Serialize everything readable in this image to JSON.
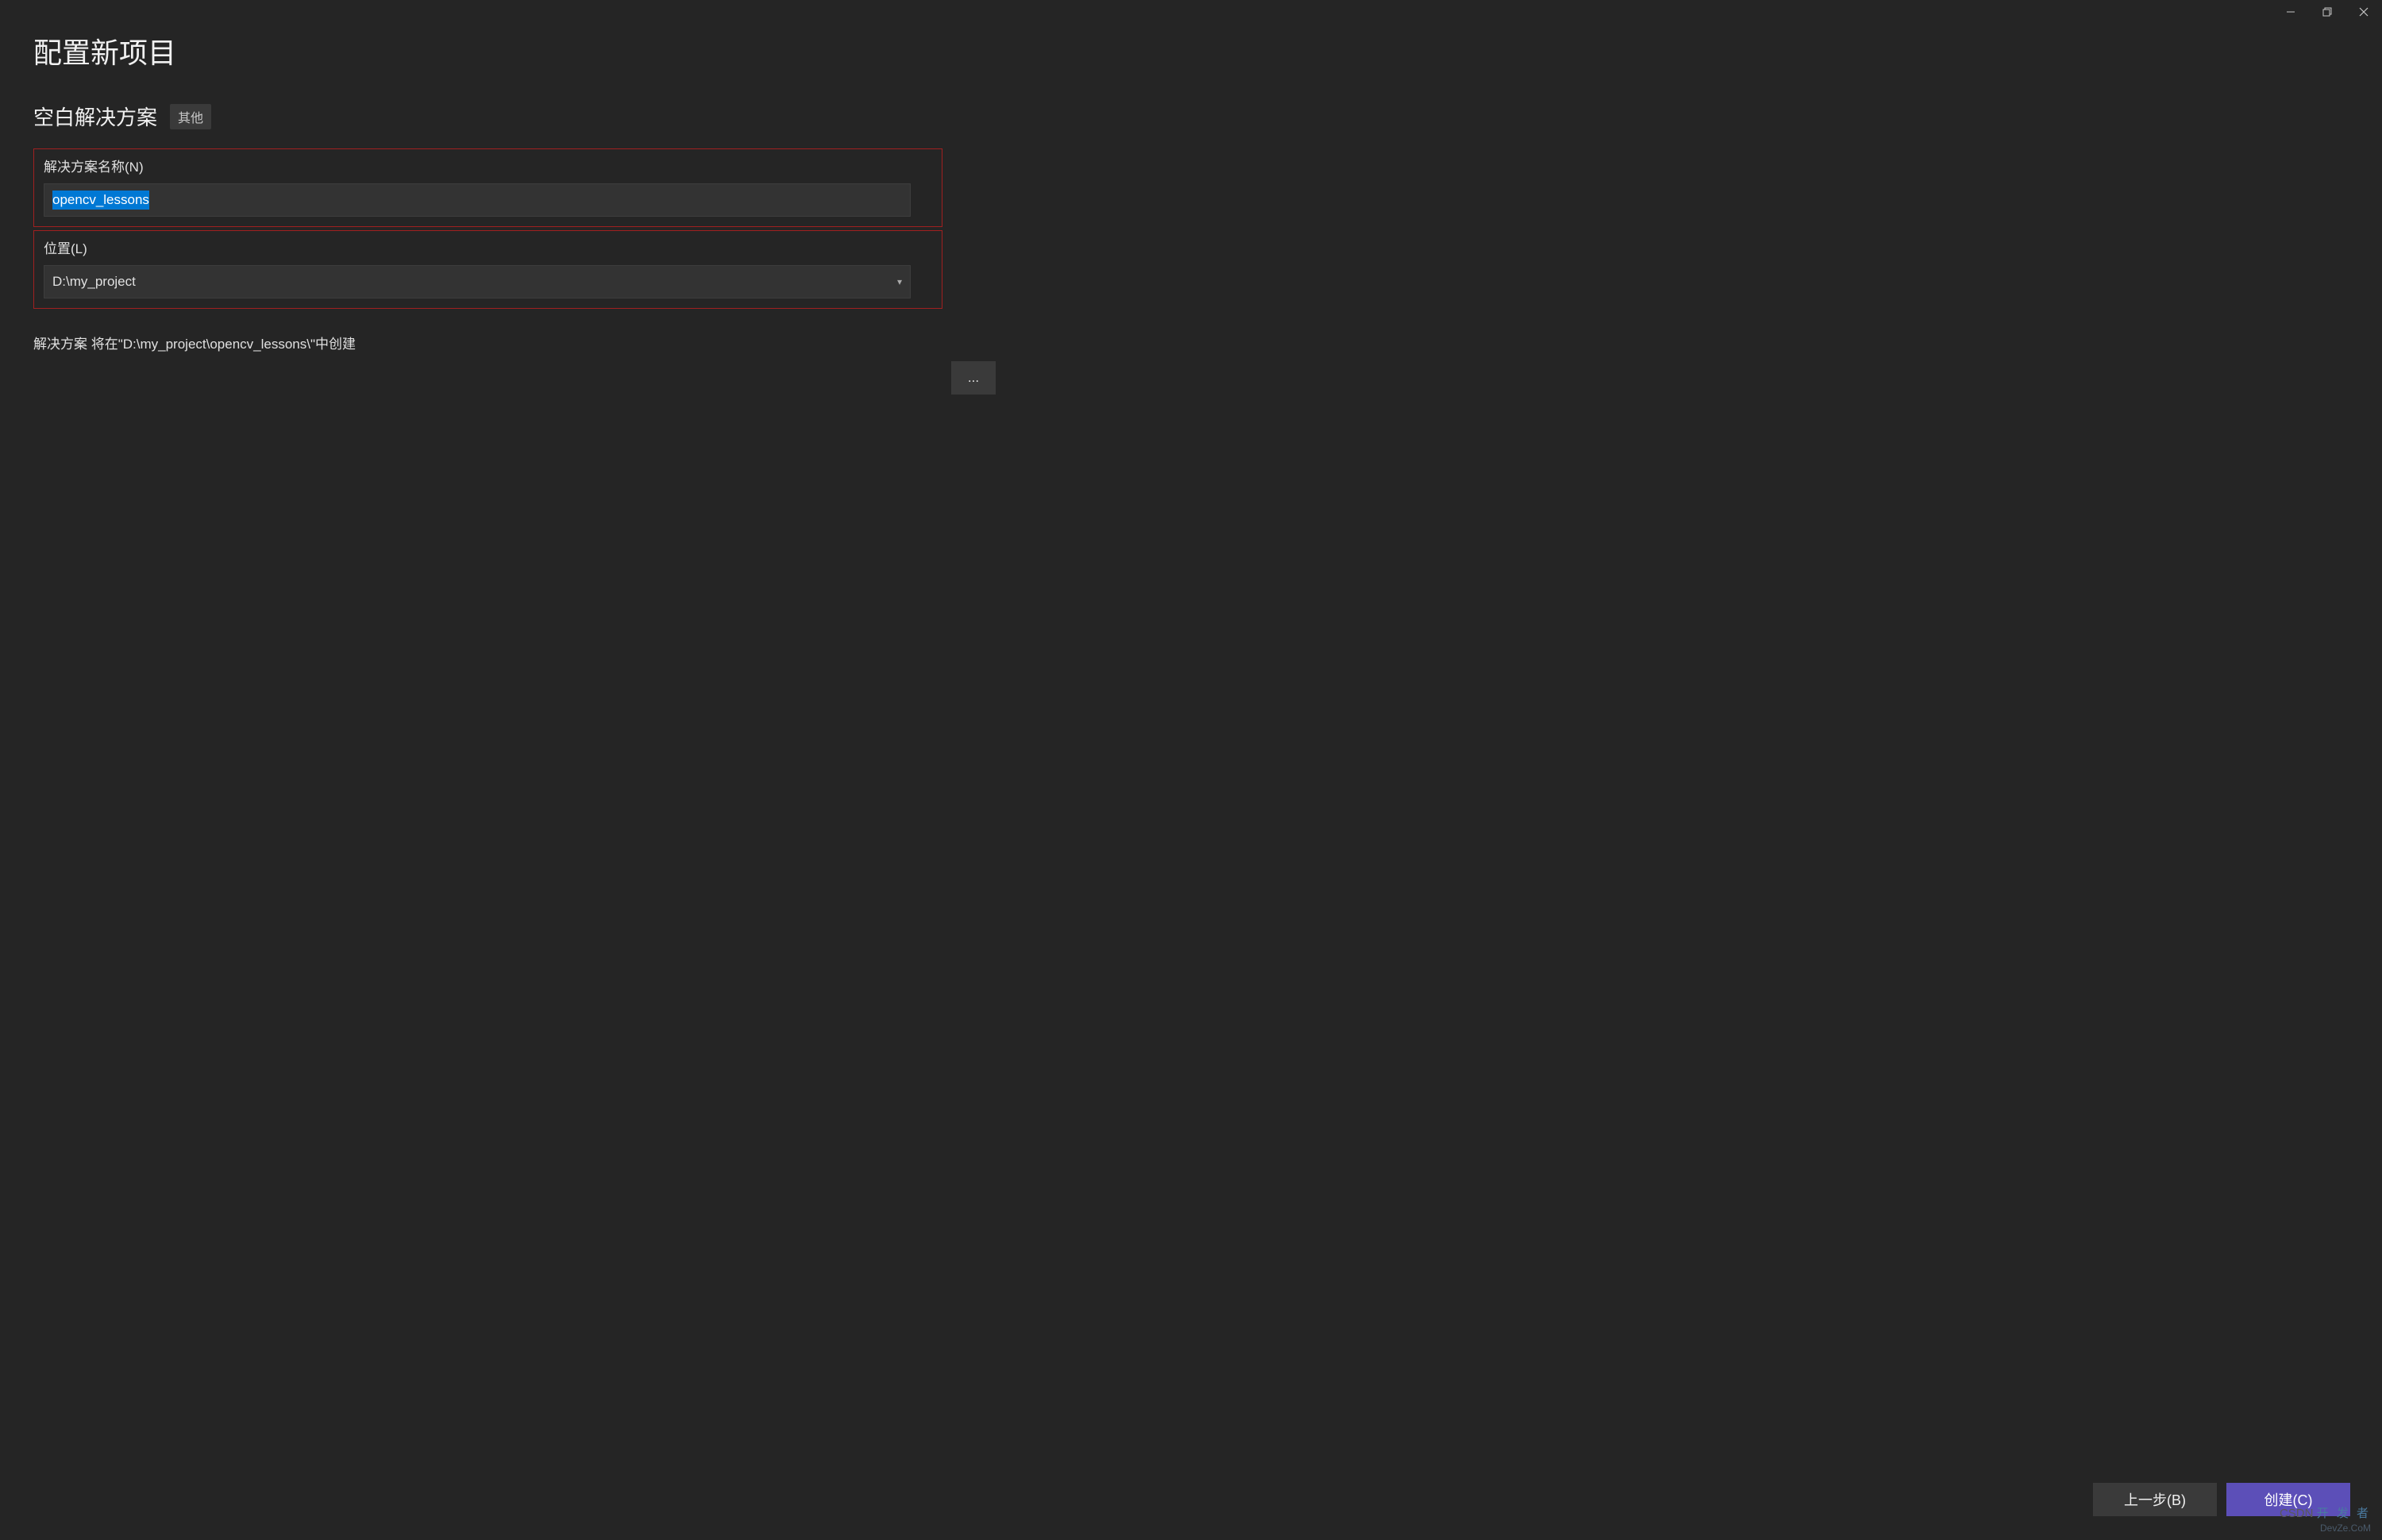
{
  "window": {
    "minimize_title": "Minimize",
    "maximize_title": "Restore",
    "close_title": "Close"
  },
  "page": {
    "title": "配置新项目",
    "subtitle": "空白解决方案",
    "tag": "其他"
  },
  "form": {
    "solution_name_label": "解决方案名称(N)",
    "solution_name_value": "opencv_lessons",
    "location_label": "位置(L)",
    "location_value": "D:\\my_project",
    "browse_label": "...",
    "info_text": "解决方案 将在\"D:\\my_project\\opencv_lessons\\\"中创建"
  },
  "footer": {
    "back_label": "上一步(B)",
    "create_label": "创建(C)"
  },
  "watermark": {
    "line1": "CSDN",
    "line2": "开 发 者",
    "line3": "DevZe.CoM"
  }
}
